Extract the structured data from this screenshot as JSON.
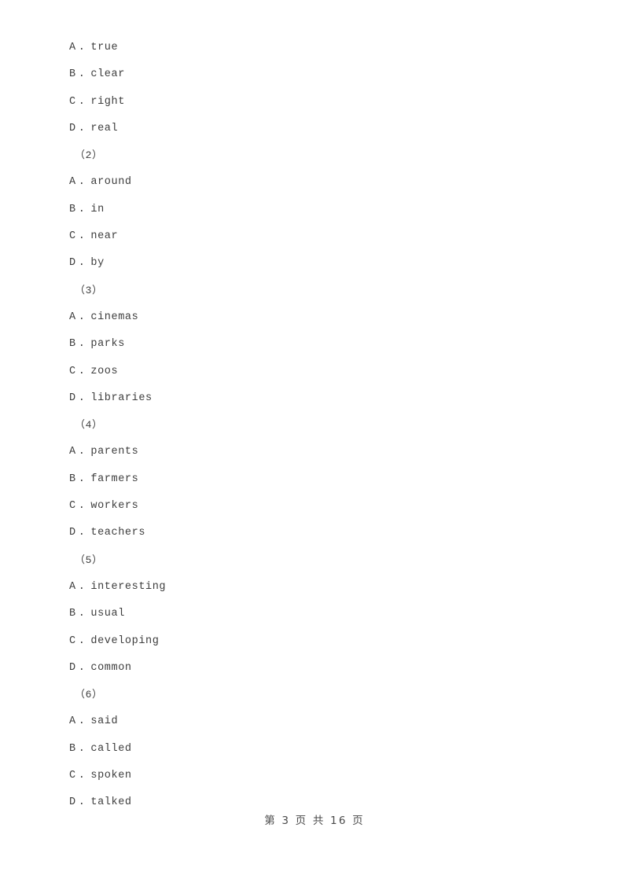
{
  "document": {
    "page_background": "#ffffff",
    "text_color": "#3d3d3d",
    "blocks": [
      {
        "kind": "option",
        "letter": "A",
        "separator": ".",
        "text": "true",
        "full": "A .  true"
      },
      {
        "kind": "option",
        "letter": "B",
        "separator": ".",
        "text": "clear",
        "full": "B .  clear"
      },
      {
        "kind": "option",
        "letter": "C",
        "separator": ".",
        "text": "right",
        "full": "C .  right"
      },
      {
        "kind": "option",
        "letter": "D",
        "separator": ".",
        "text": "real",
        "full": "D .  real"
      },
      {
        "kind": "question_number",
        "text": "（2）",
        "full": "（2）"
      },
      {
        "kind": "option",
        "letter": "A",
        "separator": ".",
        "text": "around",
        "full": "A .  around"
      },
      {
        "kind": "option",
        "letter": "B",
        "separator": ".",
        "text": "in",
        "full": "B .  in"
      },
      {
        "kind": "option",
        "letter": "C",
        "separator": ".",
        "text": "near",
        "full": "C .  near"
      },
      {
        "kind": "option",
        "letter": "D",
        "separator": ".",
        "text": "by",
        "full": "D .  by"
      },
      {
        "kind": "question_number",
        "text": "（3）",
        "full": "（3）"
      },
      {
        "kind": "option",
        "letter": "A",
        "separator": ".",
        "text": "cinemas",
        "full": "A .  cinemas"
      },
      {
        "kind": "option",
        "letter": "B",
        "separator": ".",
        "text": "parks",
        "full": "B .  parks"
      },
      {
        "kind": "option",
        "letter": "C",
        "separator": ".",
        "text": "zoos",
        "full": "C .  zoos"
      },
      {
        "kind": "option",
        "letter": "D",
        "separator": ".",
        "text": "libraries",
        "full": "D .  libraries"
      },
      {
        "kind": "question_number",
        "text": "（4）",
        "full": "（4）"
      },
      {
        "kind": "option",
        "letter": "A",
        "separator": ".",
        "text": "parents",
        "full": "A .  parents"
      },
      {
        "kind": "option",
        "letter": "B",
        "separator": ".",
        "text": "farmers",
        "full": "B .  farmers"
      },
      {
        "kind": "option",
        "letter": "C",
        "separator": ".",
        "text": "workers",
        "full": "C .  workers"
      },
      {
        "kind": "option",
        "letter": "D",
        "separator": ".",
        "text": "teachers",
        "full": "D .  teachers"
      },
      {
        "kind": "question_number",
        "text": "（5）",
        "full": "（5）"
      },
      {
        "kind": "option",
        "letter": "A",
        "separator": ".",
        "text": "interesting",
        "full": "A .  interesting"
      },
      {
        "kind": "option",
        "letter": "B",
        "separator": ".",
        "text": "usual",
        "full": "B .  usual"
      },
      {
        "kind": "option",
        "letter": "C",
        "separator": ".",
        "text": "developing",
        "full": "C .  developing"
      },
      {
        "kind": "option",
        "letter": "D",
        "separator": ".",
        "text": "common",
        "full": "D .  common"
      },
      {
        "kind": "question_number",
        "text": "（6）",
        "full": "（6）"
      },
      {
        "kind": "option",
        "letter": "A",
        "separator": ".",
        "text": "said",
        "full": "A .  said"
      },
      {
        "kind": "option",
        "letter": "B",
        "separator": ".",
        "text": "called",
        "full": "B .  called"
      },
      {
        "kind": "option",
        "letter": "C",
        "separator": ".",
        "text": "spoken",
        "full": "C .  spoken"
      },
      {
        "kind": "option",
        "letter": "D",
        "separator": ".",
        "text": "talked",
        "full": "D .  talked"
      }
    ]
  },
  "footer": {
    "text": "第 3 页 共 16 页",
    "current_page": "3",
    "total_pages": "16"
  }
}
